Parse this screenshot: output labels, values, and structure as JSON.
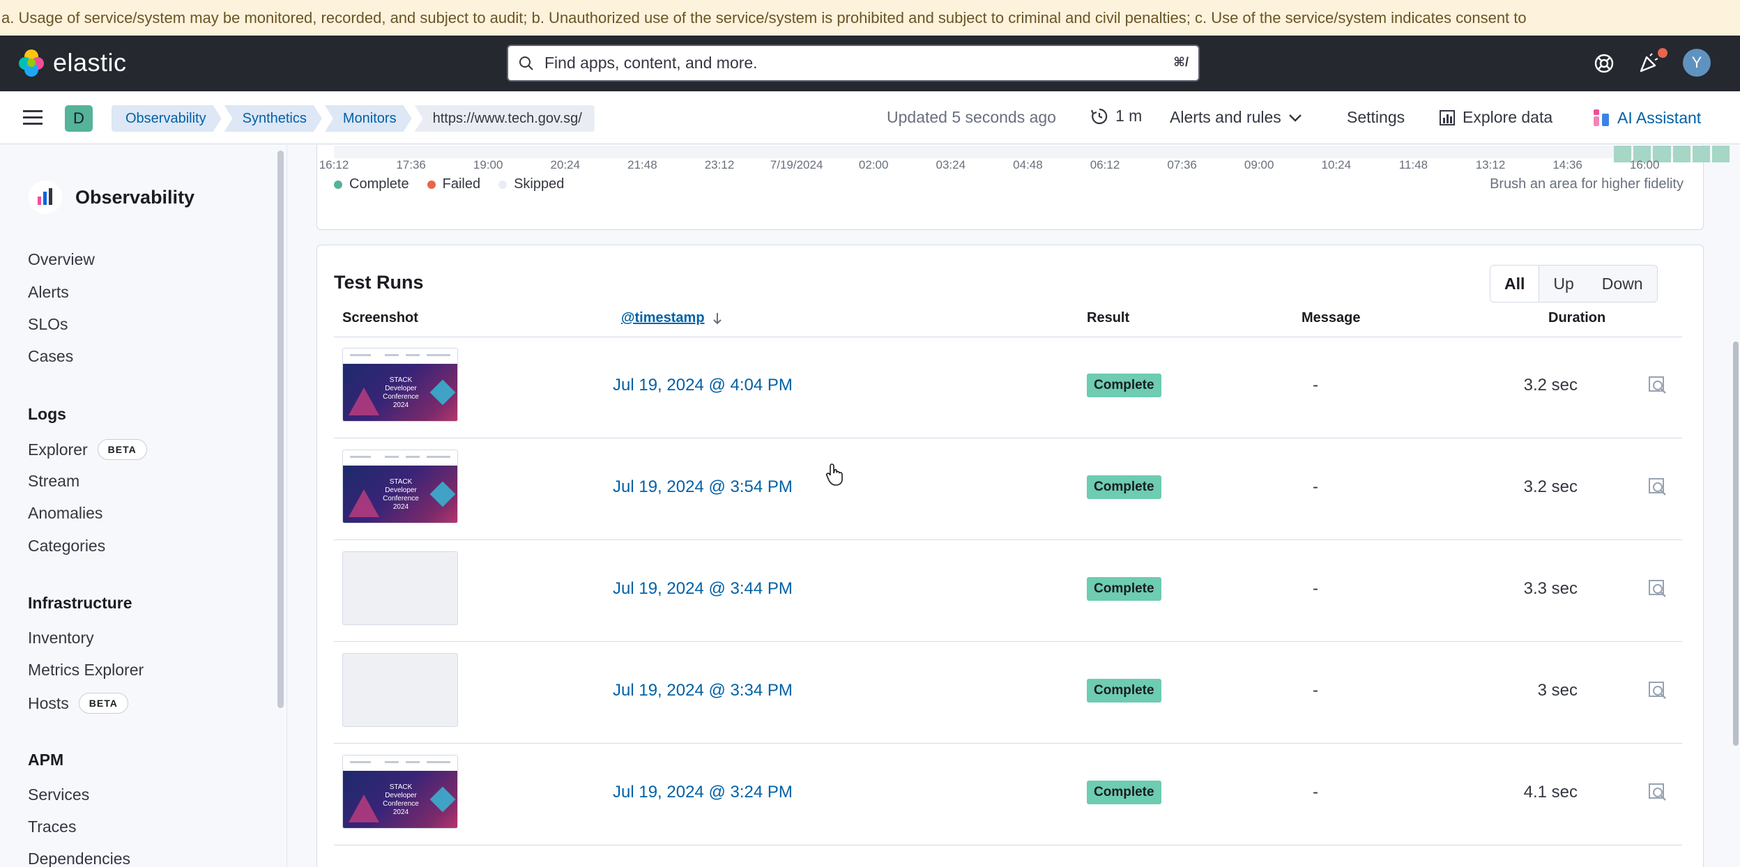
{
  "banner": {
    "text": "a. Usage of service/system may be monitored, recorded, and subject to audit; b. Unauthorized use of the service/system is prohibited and subject to criminal and civil penalties; c. Use of the service/system indicates consent to"
  },
  "header": {
    "logo_text": "elastic",
    "search_placeholder": "Find apps, content, and more.",
    "search_shortcut": "⌘/",
    "avatar_initial": "Y"
  },
  "subheader": {
    "space_initial": "D",
    "breadcrumbs": [
      "Observability",
      "Synthetics",
      "Monitors",
      "https://www.tech.gov.sg/"
    ],
    "updated": "Updated 5 seconds ago",
    "refresh_interval": "1 m",
    "alerts_label": "Alerts and rules",
    "settings_label": "Settings",
    "explore_label": "Explore data",
    "ai_label": "AI Assistant"
  },
  "sidebar": {
    "title": "Observability",
    "top_items": [
      "Overview",
      "Alerts",
      "SLOs",
      "Cases"
    ],
    "sections": [
      {
        "title": "Logs",
        "items": [
          {
            "label": "Explorer",
            "badge": "BETA"
          },
          {
            "label": "Stream"
          },
          {
            "label": "Anomalies"
          },
          {
            "label": "Categories"
          }
        ]
      },
      {
        "title": "Infrastructure",
        "items": [
          {
            "label": "Inventory"
          },
          {
            "label": "Metrics Explorer"
          },
          {
            "label": "Hosts",
            "badge": "BETA"
          }
        ]
      },
      {
        "title": "APM",
        "items": [
          {
            "label": "Services"
          },
          {
            "label": "Traces"
          },
          {
            "label": "Dependencies"
          }
        ]
      }
    ]
  },
  "histogram": {
    "ticks": [
      "16:12",
      "17:36",
      "19:00",
      "20:24",
      "21:48",
      "23:12",
      "7/19/2024",
      "02:00",
      "03:24",
      "04:48",
      "06:12",
      "07:36",
      "09:00",
      "10:24",
      "11:48",
      "13:12",
      "14:36",
      "16:00"
    ],
    "legend": [
      {
        "label": "Complete",
        "color": "#54b399"
      },
      {
        "label": "Failed",
        "color": "#e7664c"
      },
      {
        "label": "Skipped",
        "color": "#d3dae6"
      }
    ],
    "hint": "Brush an area for higher fidelity"
  },
  "test_runs": {
    "title": "Test Runs",
    "filters": [
      "All",
      "Up",
      "Down"
    ],
    "active_filter": "All",
    "columns": {
      "screenshot": "Screenshot",
      "timestamp": "@timestamp",
      "result": "Result",
      "message": "Message",
      "duration": "Duration"
    },
    "thumb_caption": "STACK Developer Conference 2024",
    "rows": [
      {
        "timestamp": "Jul 19, 2024 @ 4:04 PM",
        "result": "Complete",
        "message": "-",
        "duration": "3.2 sec",
        "has_image": true
      },
      {
        "timestamp": "Jul 19, 2024 @ 3:54 PM",
        "result": "Complete",
        "message": "-",
        "duration": "3.2 sec",
        "has_image": true
      },
      {
        "timestamp": "Jul 19, 2024 @ 3:44 PM",
        "result": "Complete",
        "message": "-",
        "duration": "3.3 sec",
        "has_image": false
      },
      {
        "timestamp": "Jul 19, 2024 @ 3:34 PM",
        "result": "Complete",
        "message": "-",
        "duration": "3 sec",
        "has_image": false
      },
      {
        "timestamp": "Jul 19, 2024 @ 3:24 PM",
        "result": "Complete",
        "message": "-",
        "duration": "4.1 sec",
        "has_image": true
      }
    ]
  }
}
